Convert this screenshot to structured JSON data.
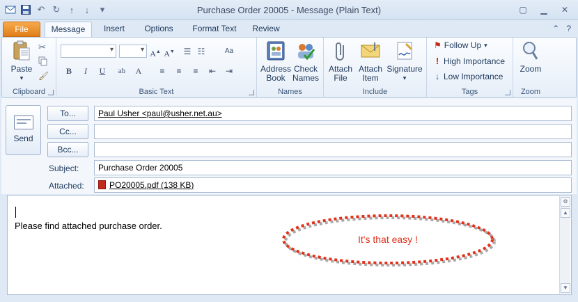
{
  "window": {
    "title": "Purchase Order 20005  -  Message (Plain Text)"
  },
  "tabs": [
    {
      "label": "File"
    },
    {
      "label": "Message"
    },
    {
      "label": "Insert"
    },
    {
      "label": "Options"
    },
    {
      "label": "Format Text"
    },
    {
      "label": "Review"
    }
  ],
  "ribbon": {
    "clipboard": {
      "label": "Clipboard",
      "paste": "Paste"
    },
    "basic_text": {
      "label": "Basic Text"
    },
    "names": {
      "label": "Names",
      "address_book_1": "Address",
      "address_book_2": "Book",
      "check_names_1": "Check",
      "check_names_2": "Names"
    },
    "include": {
      "label": "Include",
      "attach_file_1": "Attach",
      "attach_file_2": "File",
      "attach_item_1": "Attach",
      "attach_item_2": "Item",
      "signature": "Signature"
    },
    "tags": {
      "label": "Tags",
      "follow_up": "Follow Up",
      "high_importance": "High Importance",
      "low_importance": "Low Importance"
    },
    "zoom": {
      "label": "Zoom",
      "zoom_button": "Zoom"
    }
  },
  "compose": {
    "send": "Send",
    "to_button": "To...",
    "cc_button": "Cc...",
    "bcc_button": "Bcc...",
    "to_value": "Paul Usher <paul@usher.net.au>",
    "cc_value": "",
    "bcc_value": "",
    "subject_label": "Subject:",
    "subject_value": "Purchase Order 20005",
    "attached_label": "Attached:",
    "attachment": "PO20005.pdf (138 KB)"
  },
  "body": {
    "text": "Please find attached purchase order.",
    "callout": "It's that easy !"
  },
  "colors": {
    "file_tab": "#e07f1a",
    "callout": "#e0311b",
    "ribbon_bg": "#f7fafe"
  }
}
